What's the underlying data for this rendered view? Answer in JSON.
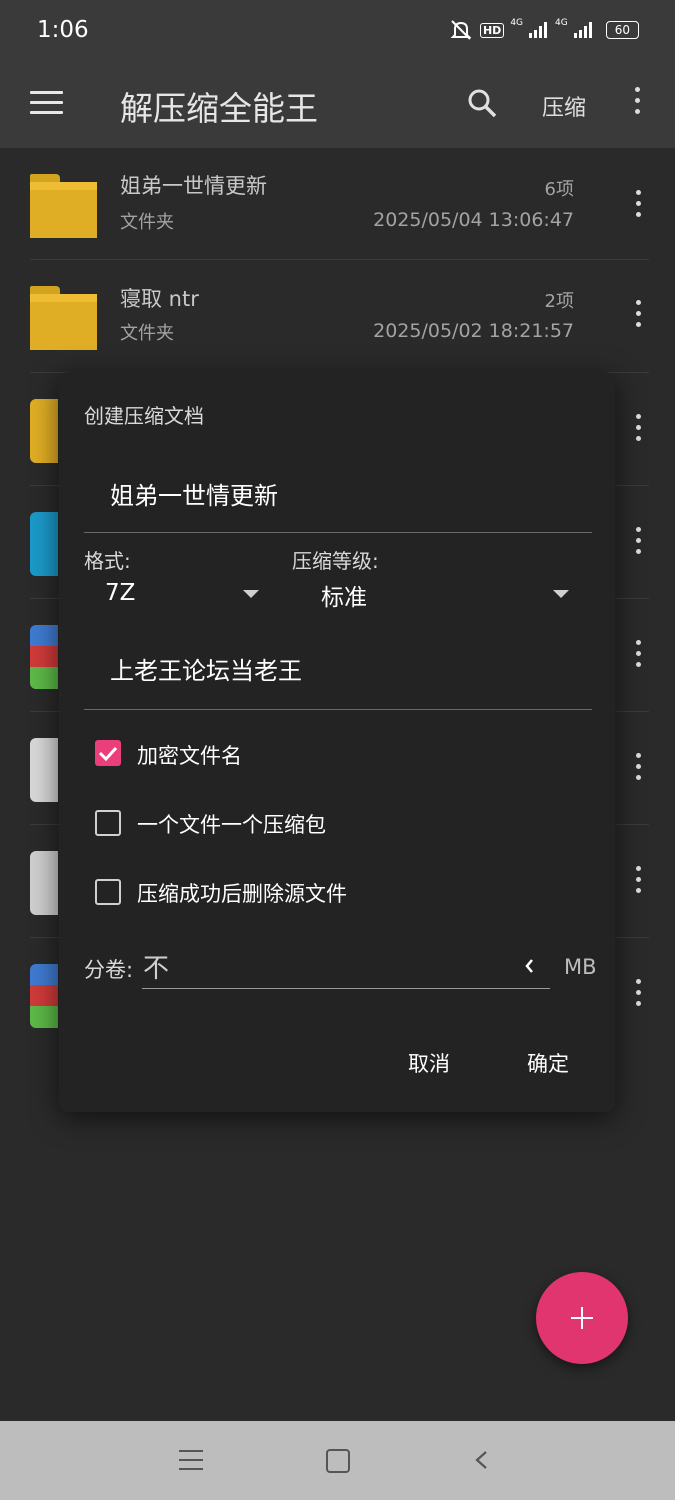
{
  "status_bar": {
    "time": "1:06",
    "hd_label": "HD",
    "net1": "4G",
    "net2": "4G",
    "battery": "60"
  },
  "app_bar": {
    "title": "解压缩全能王",
    "compress_label": "压缩"
  },
  "files": [
    {
      "name": "姐弟一世情更新",
      "type": "文件夹",
      "count": "6项",
      "date": "2025/05/04 13:06:47"
    },
    {
      "name": "寝取 ntr",
      "type": "文件夹",
      "count": "2项",
      "date": "2025/05/02 18:21:57"
    }
  ],
  "dialog": {
    "title": "创建压缩文档",
    "archive_name": "姐弟一世情更新",
    "format_label": "格式:",
    "format_value": "7Z",
    "level_label": "压缩等级:",
    "level_value": "标准",
    "password": "上老王论坛当老王",
    "options": [
      {
        "label": "加密文件名",
        "checked": true
      },
      {
        "label": "一个文件一个压缩包",
        "checked": false
      },
      {
        "label": "压缩成功后删除源文件",
        "checked": false
      }
    ],
    "volume_label": "分卷:",
    "volume_value": "不",
    "volume_unit": "MB",
    "cancel": "取消",
    "confirm": "确定"
  },
  "colors": {
    "accent": "#e0356f",
    "folder": "#e0ae25",
    "background": "#2a2a2a",
    "appbar": "#3a3a3a"
  }
}
